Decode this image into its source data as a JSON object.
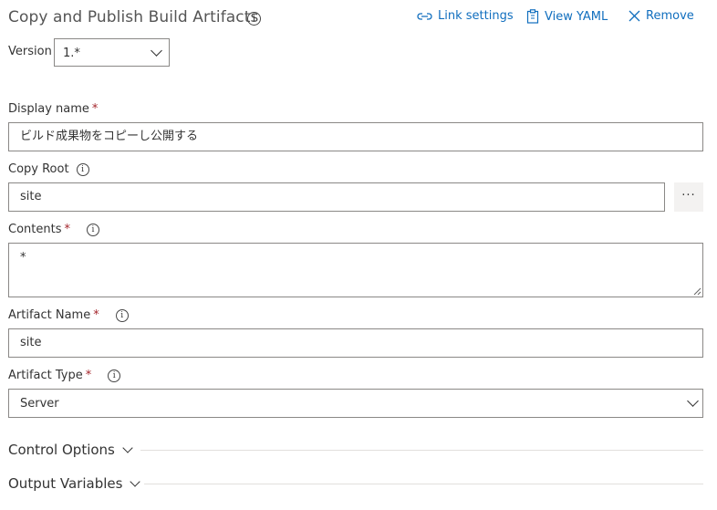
{
  "header": {
    "title": "Copy and Publish Build Artifacts",
    "actions": {
      "link_settings": "Link settings",
      "view_yaml": "View YAML",
      "remove": "Remove"
    }
  },
  "version": {
    "label": "Version",
    "value": "1.*"
  },
  "fields": {
    "display_name": {
      "label": "Display name",
      "required": "*",
      "value": "ビルド成果物をコピーし公開する"
    },
    "copy_root": {
      "label": "Copy Root",
      "value": "site",
      "browse": "···"
    },
    "contents": {
      "label": "Contents",
      "required": "*",
      "value": "*"
    },
    "artifact_name": {
      "label": "Artifact Name",
      "required": "*",
      "value": "site"
    },
    "artifact_type": {
      "label": "Artifact Type",
      "required": "*",
      "value": "Server"
    }
  },
  "sections": {
    "control_options": "Control Options",
    "output_variables": "Output Variables"
  },
  "icons": {
    "info": "i",
    "link": "link-icon",
    "clipboard": "clipboard-icon",
    "close": "close-icon"
  },
  "colors": {
    "accent": "#106ebe",
    "required": "#a4262c",
    "border": "#8a8886"
  }
}
